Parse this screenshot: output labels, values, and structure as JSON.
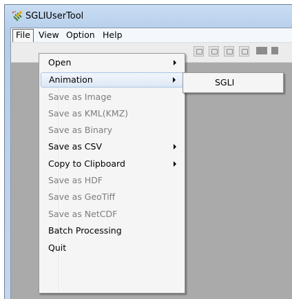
{
  "window": {
    "title": "SGLIUserTool",
    "app_icon": "satellite-app-icon"
  },
  "menubar": {
    "items": [
      {
        "label": "File",
        "open": true
      },
      {
        "label": "View"
      },
      {
        "label": "Option"
      },
      {
        "label": "Help"
      }
    ]
  },
  "file_menu": {
    "items": [
      {
        "label": "Open",
        "submenu": true,
        "enabled": true
      },
      {
        "label": "Animation",
        "submenu": true,
        "enabled": true,
        "highlighted": true
      },
      {
        "label": "Save as Image",
        "enabled": false
      },
      {
        "label": "Save as KML(KMZ)",
        "enabled": false
      },
      {
        "label": "Save as Binary",
        "enabled": false
      },
      {
        "label": "Save as CSV",
        "submenu": true,
        "enabled": true
      },
      {
        "label": "Copy to Clipboard",
        "submenu": true,
        "enabled": true
      },
      {
        "label": "Save as HDF",
        "enabled": false
      },
      {
        "label": "Save as GeoTiff",
        "enabled": false
      },
      {
        "label": "Save as NetCDF",
        "enabled": false
      },
      {
        "label": "Batch Processing",
        "enabled": true
      },
      {
        "label": "Quit",
        "enabled": true
      }
    ]
  },
  "animation_submenu": {
    "items": [
      {
        "label": "SGLI"
      }
    ]
  },
  "colors": {
    "highlight_border": "#a8c4e6",
    "disabled_text": "#7d7d7d",
    "content_background": "#aaaaaa"
  }
}
